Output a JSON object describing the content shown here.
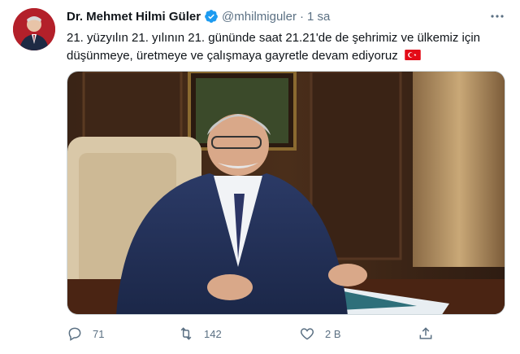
{
  "author": {
    "display_name": "Dr. Mehmet Hilmi Güler",
    "handle": "@mhilmiguler",
    "separator": "·",
    "time": "1 sa"
  },
  "tweet": {
    "text": "21. yüzyılın 21. yılının 21. gününde saat 21.21'de de şehrimiz ve ülkemiz için düşünmeye, üretmeye ve çalışmaya gayretle devam ediyoruz",
    "emoji": "flag-turkey"
  },
  "actions": {
    "replies": "71",
    "retweets": "142",
    "likes": "2 B"
  },
  "icons": {
    "verified": "verified-badge-icon",
    "more": "more-options-icon",
    "reply": "reply-icon",
    "retweet": "retweet-icon",
    "like": "heart-icon",
    "share": "share-icon"
  },
  "colors": {
    "accent": "#1d9bf0",
    "muted": "#5b7083",
    "flag_red": "#e30a17"
  }
}
